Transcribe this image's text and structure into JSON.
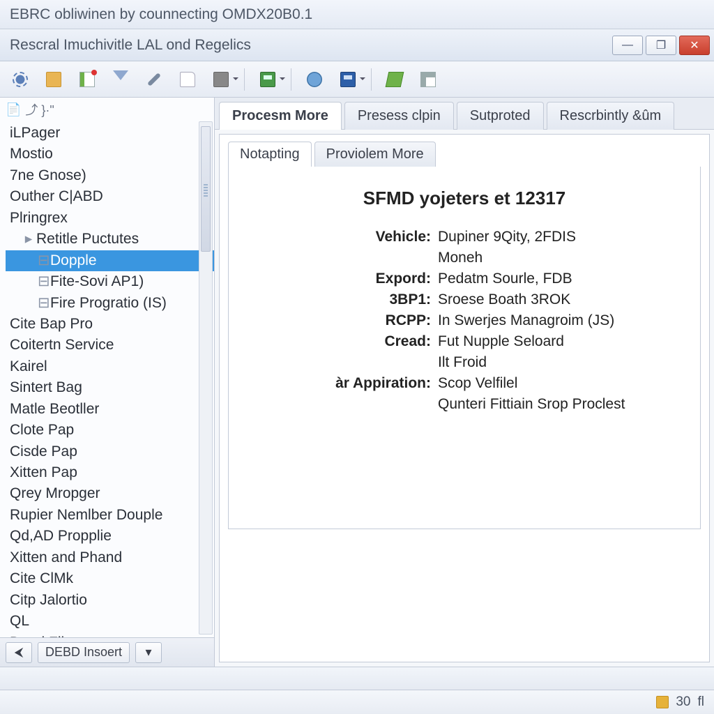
{
  "outer_title": "EBRC obliwinen by counnecting OMDX20B0.1",
  "inner_title": "Rescral Imuchivitle LAL ond Regelics",
  "win_controls": {
    "min": "—",
    "max": "❐",
    "close": "✕"
  },
  "toolbar_icons": [
    "gear",
    "folder",
    "sheet",
    "funnel",
    "pen",
    "page",
    "print",
    "sep",
    "disk",
    "sep",
    "globe",
    "save",
    "sep",
    "book",
    "grid"
  ],
  "tree_header": "⤴  }·\"",
  "tree": [
    {
      "label": "iLPager",
      "lvl": 0
    },
    {
      "label": "Mostio",
      "lvl": 0
    },
    {
      "label": "7ne Gnose)",
      "lvl": 0
    },
    {
      "label": "Outher C|ABD",
      "lvl": 0
    },
    {
      "label": "Plringrex",
      "lvl": 0
    },
    {
      "label": "Retitle Puctutes",
      "lvl": 1,
      "expandable": true
    },
    {
      "label": "Dopple",
      "lvl": 2,
      "selected": true
    },
    {
      "label": "Fite-Sovi AP1)",
      "lvl": 2
    },
    {
      "label": "Fire Progratio (IS)",
      "lvl": 2
    },
    {
      "label": "Cite Bap Pro",
      "lvl": 0
    },
    {
      "label": "Coitertn Service",
      "lvl": 0
    },
    {
      "label": "Kairel",
      "lvl": 0
    },
    {
      "label": "Sintert Bag",
      "lvl": 0
    },
    {
      "label": "Matle Beotller",
      "lvl": 0
    },
    {
      "label": "Clote Pap",
      "lvl": 0
    },
    {
      "label": "Cisde Pap",
      "lvl": 0
    },
    {
      "label": "Xitten Pap",
      "lvl": 0
    },
    {
      "label": "Qrey Mropger",
      "lvl": 0
    },
    {
      "label": "Rupier Nemlber Douple",
      "lvl": 0
    },
    {
      "label": "Qd,AD Propplie",
      "lvl": 0
    },
    {
      "label": "Xitten and Phand",
      "lvl": 0
    },
    {
      "label": "Cite ClMk",
      "lvl": 0
    },
    {
      "label": "Citp Jalortio",
      "lvl": 0
    },
    {
      "label": "QL",
      "lvl": 0
    },
    {
      "label": "Daad Filc",
      "lvl": 0
    }
  ],
  "side_bottom": {
    "back_icon": "⮜",
    "insert_label": "DEBD Insoert",
    "drop": "▾"
  },
  "tabs_top": [
    {
      "label": "Procesm More",
      "active": true
    },
    {
      "label": "Presess clpin",
      "active": false
    },
    {
      "label": "Sutproted",
      "active": false
    },
    {
      "label": "Rescrbintly &ûm",
      "active": false
    }
  ],
  "tabs_sub": [
    {
      "label": "Notapting",
      "active": true
    },
    {
      "label": "Proviolem More",
      "active": false
    }
  ],
  "doc": {
    "title": "SFMD yojeters et 12317",
    "rows": [
      {
        "k": "Vehicle:",
        "v": "Dupiner 9Qity, 2FDIS"
      },
      {
        "k": "",
        "v": "Moneh"
      },
      {
        "k": "Expord:",
        "v": "Pedatm Sourle, FDB"
      },
      {
        "k": "3BP1:",
        "v": "Sroese Boath 3ROK"
      },
      {
        "k": "RCPP:",
        "v": "In Swerjes Managroim (JS)"
      },
      {
        "k": "Cread:",
        "v": "Fut Nupple Seloard"
      },
      {
        "k": "",
        "v": "Ilt Froid"
      },
      {
        "k": "àr Appiration:",
        "v": "Scop Velfilel"
      },
      {
        "k": "",
        "v": "Qunteri Fittiain Srop Proclest"
      }
    ]
  },
  "status": {
    "count": "30",
    "suffix": "fl"
  }
}
